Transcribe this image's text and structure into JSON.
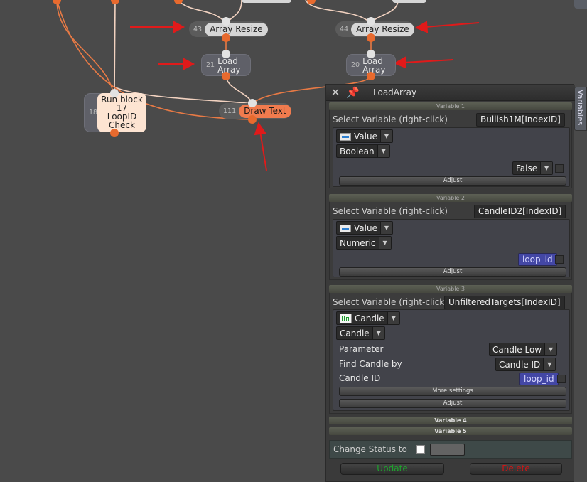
{
  "nodes": {
    "array_resize_a": {
      "num": "43",
      "label": "Array Resize"
    },
    "array_resize_b": {
      "num": "44",
      "label": "Array Resize"
    },
    "load_array_a": {
      "num": "21",
      "label": "Load Array"
    },
    "load_array_b": {
      "num": "20",
      "label": "Load Array"
    },
    "run_block": {
      "num": "18",
      "label_lines": [
        "Run block",
        "17",
        "LoopID",
        "Check"
      ]
    },
    "draw_text": {
      "num": "111",
      "label": "Draw Text"
    }
  },
  "panel": {
    "title": "LoadArray",
    "variables_tab": "Variables",
    "var1": {
      "header": "Variable 1",
      "select_label": "Select Variable (right-click)",
      "var_name": "Bullish1M[IndexID]",
      "source_type": "Value",
      "data_type": "Boolean",
      "value": "False",
      "adjust": "Adjust"
    },
    "var2": {
      "header": "Variable 2",
      "select_label": "Select Variable (right-click)",
      "var_name": "CandleID2[IndexID]",
      "source_type": "Value",
      "data_type": "Numeric",
      "value": "loop_id",
      "adjust": "Adjust"
    },
    "var3": {
      "header": "Variable 3",
      "select_label": "Select Variable (right-click)",
      "var_name": "UnfilteredTargets[IndexID]",
      "source_type": "Candle",
      "data_type": "Candle",
      "parameter_label": "Parameter",
      "parameter_value": "Candle Low",
      "find_by_label": "Find Candle by",
      "find_by_value": "Candle ID",
      "candle_id_label": "Candle ID",
      "candle_id_value": "loop_id",
      "more_settings": "More settings",
      "adjust": "Adjust"
    },
    "var4_header": "Variable 4",
    "var5_header": "Variable 5",
    "change_status_label": "Change Status to",
    "update_label": "Update",
    "delete_label": "Delete"
  },
  "colors": {
    "canvas_bg": "#4a4a4a",
    "wire_light": "#f0c8b0",
    "wire_orange": "#e87a45",
    "output_port": "#e86a2e",
    "arrow": "#e01a1a",
    "update_green": "#1ea52e",
    "delete_red": "#d01515",
    "draw_text_node": "#f07b4e",
    "run_block_node": "#fde4d2"
  }
}
